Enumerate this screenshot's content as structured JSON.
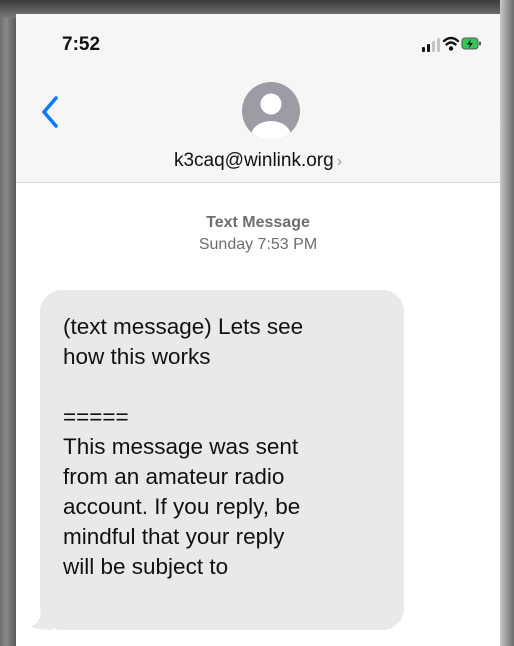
{
  "status_bar": {
    "time": "7:52",
    "icons": [
      "signal-icon",
      "wifi-icon",
      "battery-charging-icon"
    ]
  },
  "nav": {
    "back_icon": "chevron-left-icon",
    "contact_name": "k3caq@winlink.org",
    "contact_chevron": "›",
    "avatar_icon": "person-avatar-icon"
  },
  "thread": {
    "service_label": "Text Message",
    "timestamp": "Sunday 7:53 PM"
  },
  "messages": [
    {
      "direction": "received",
      "text": "(text message) Lets see\nhow this works\n\n=====\nThis message was sent\nfrom an amateur radio\naccount. If you reply, be\nmindful that your reply\nwill be subject to"
    }
  ],
  "colors": {
    "accent": "#0a7aff",
    "received_bubble": "#e9e9eb",
    "meta_text": "#6d6d72",
    "avatar_bg": "#9b9ca4",
    "battery_charge": "#34c759"
  }
}
